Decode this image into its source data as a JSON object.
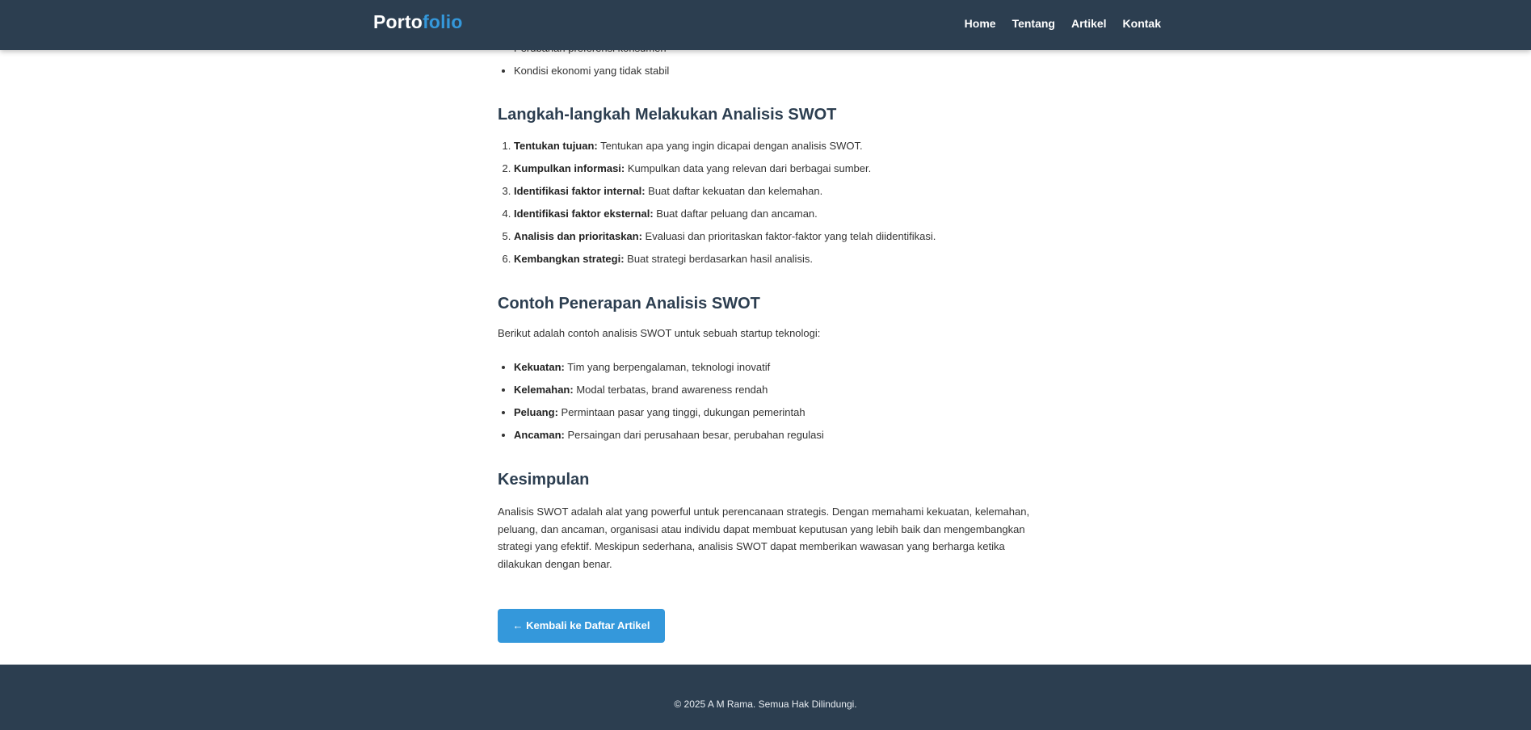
{
  "nav": {
    "brand_part1": "Porto",
    "brand_part2": "folio",
    "links": [
      "Home",
      "Tentang",
      "Artikel",
      "Kontak"
    ]
  },
  "article": {
    "threats_partial": [
      "Perubahan preferensi konsumen",
      "Kondisi ekonomi yang tidak stabil"
    ],
    "steps_heading": "Langkah-langkah Melakukan Analisis SWOT",
    "steps": [
      {
        "label": "Tentukan tujuan:",
        "text": " Tentukan apa yang ingin dicapai dengan analisis SWOT."
      },
      {
        "label": "Kumpulkan informasi:",
        "text": " Kumpulkan data yang relevan dari berbagai sumber."
      },
      {
        "label": "Identifikasi faktor internal:",
        "text": " Buat daftar kekuatan dan kelemahan."
      },
      {
        "label": "Identifikasi faktor eksternal:",
        "text": " Buat daftar peluang dan ancaman."
      },
      {
        "label": "Analisis dan prioritaskan:",
        "text": " Evaluasi dan prioritaskan faktor-faktor yang telah diidentifikasi."
      },
      {
        "label": "Kembangkan strategi:",
        "text": " Buat strategi berdasarkan hasil analisis."
      }
    ],
    "example_heading": "Contoh Penerapan Analisis SWOT",
    "example_intro": "Berikut adalah contoh analisis SWOT untuk sebuah startup teknologi:",
    "example_items": [
      {
        "label": "Kekuatan:",
        "text": " Tim yang berpengalaman, teknologi inovatif"
      },
      {
        "label": "Kelemahan:",
        "text": " Modal terbatas, brand awareness rendah"
      },
      {
        "label": "Peluang:",
        "text": " Permintaan pasar yang tinggi, dukungan pemerintah"
      },
      {
        "label": "Ancaman:",
        "text": " Persaingan dari perusahaan besar, perubahan regulasi"
      }
    ],
    "conclusion_heading": "Kesimpulan",
    "conclusion_text": "Analisis SWOT adalah alat yang powerful untuk perencanaan strategis. Dengan memahami kekuatan, kelemahan, peluang, dan ancaman, organisasi atau individu dapat membuat keputusan yang lebih baik dan mengembangkan strategi yang efektif. Meskipun sederhana, analisis SWOT dapat memberikan wawasan yang berharga ketika dilakukan dengan benar.",
    "back_button": "← Kembali ke Daftar Artikel"
  },
  "footer": {
    "copyright": "© 2025 A M Rama. Semua Hak Dilindungi."
  },
  "colors": {
    "navbar_bg": "#2c3e50",
    "accent": "#3498db",
    "heading": "#2c3e50"
  }
}
